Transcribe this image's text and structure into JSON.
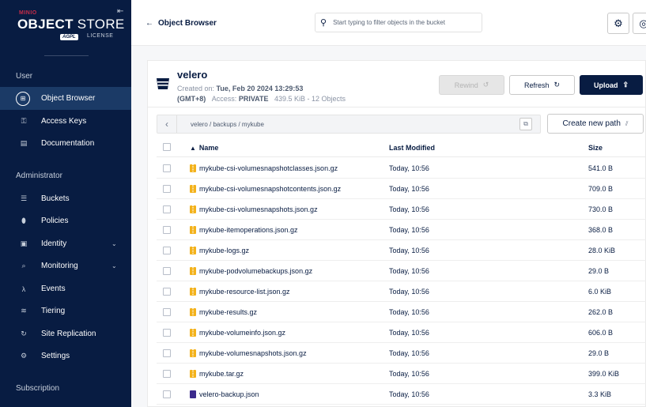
{
  "brand": {
    "vendor": "MINIO",
    "product_bold": "OBJECT",
    "product_light": " STORE",
    "license_badge": "AGPL",
    "license_label": "LICENSE"
  },
  "sidebar": {
    "sections": {
      "user": "User",
      "admin": "Administrator",
      "subscription": "Subscription"
    },
    "items": [
      {
        "label": "Object Browser",
        "icon": "object-browser-icon"
      },
      {
        "label": "Access Keys",
        "icon": "access-keys-icon"
      },
      {
        "label": "Documentation",
        "icon": "documentation-icon"
      },
      {
        "label": "Buckets",
        "icon": "buckets-icon"
      },
      {
        "label": "Policies",
        "icon": "policies-icon"
      },
      {
        "label": "Identity",
        "icon": "identity-icon"
      },
      {
        "label": "Monitoring",
        "icon": "monitoring-icon"
      },
      {
        "label": "Events",
        "icon": "events-icon"
      },
      {
        "label": "Tiering",
        "icon": "tiering-icon"
      },
      {
        "label": "Site Replication",
        "icon": "site-replication-icon"
      },
      {
        "label": "Settings",
        "icon": "settings-icon"
      }
    ]
  },
  "topbar": {
    "back_label": "Object Browser",
    "filter_placeholder": "Start typing to filter objects in the bucket"
  },
  "bucket": {
    "name": "velero",
    "created_prefix": "Created on:",
    "created_date": "Tue, Feb 20 2024 13:29:53",
    "timezone": "(GMT+8)",
    "access_prefix": "Access:",
    "access": "PRIVATE",
    "usage": "439.5 KiB - 12 Objects"
  },
  "actions": {
    "rewind": "Rewind",
    "refresh": "Refresh",
    "upload": "Upload",
    "create_path": "Create new path"
  },
  "path": "velero / backups / mykube",
  "table": {
    "headers": {
      "name": "Name",
      "modified": "Last Modified",
      "size": "Size"
    },
    "rows": [
      {
        "name": "mykube-csi-volumesnapshotclasses.json.gz",
        "modified": "Today, 10:56",
        "size": "541.0 B",
        "type": "gz"
      },
      {
        "name": "mykube-csi-volumesnapshotcontents.json.gz",
        "modified": "Today, 10:56",
        "size": "709.0 B",
        "type": "gz"
      },
      {
        "name": "mykube-csi-volumesnapshots.json.gz",
        "modified": "Today, 10:56",
        "size": "730.0 B",
        "type": "gz"
      },
      {
        "name": "mykube-itemoperations.json.gz",
        "modified": "Today, 10:56",
        "size": "368.0 B",
        "type": "gz"
      },
      {
        "name": "mykube-logs.gz",
        "modified": "Today, 10:56",
        "size": "28.0 KiB",
        "type": "gz"
      },
      {
        "name": "mykube-podvolumebackups.json.gz",
        "modified": "Today, 10:56",
        "size": "29.0 B",
        "type": "gz"
      },
      {
        "name": "mykube-resource-list.json.gz",
        "modified": "Today, 10:56",
        "size": "6.0 KiB",
        "type": "gz"
      },
      {
        "name": "mykube-results.gz",
        "modified": "Today, 10:56",
        "size": "262.0 B",
        "type": "gz"
      },
      {
        "name": "mykube-volumeinfo.json.gz",
        "modified": "Today, 10:56",
        "size": "606.0 B",
        "type": "gz"
      },
      {
        "name": "mykube-volumesnapshots.json.gz",
        "modified": "Today, 10:56",
        "size": "29.0 B",
        "type": "gz"
      },
      {
        "name": "mykube.tar.gz",
        "modified": "Today, 10:56",
        "size": "399.0 KiB",
        "type": "gz"
      },
      {
        "name": "velero-backup.json",
        "modified": "Today, 10:56",
        "size": "3.3 KiB",
        "type": "json"
      }
    ]
  },
  "colors": {
    "sidebar_bg": "#081c42",
    "sidebar_active": "#1b3a66",
    "brand_red": "#c72c48",
    "primary": "#081c42",
    "gz_icon": "#f3b21b",
    "json_icon": "#3b2a8c"
  }
}
